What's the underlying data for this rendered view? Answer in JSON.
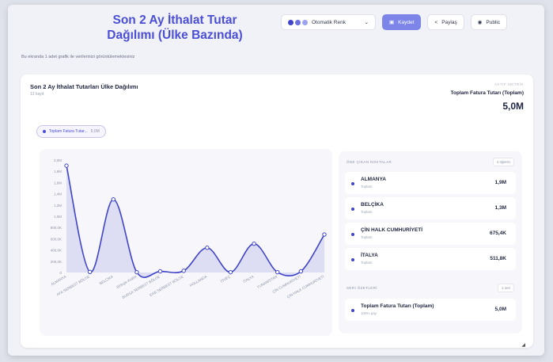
{
  "header": {
    "title": "Son 2 Ay İthalat Tutar Dağılımı (Ülke Bazında)",
    "subtitle": "Bu ekranda 1 adet grafik ile verilerinizi görüntülemektesiniz"
  },
  "toolbar": {
    "color_label": "Otomatik Renk",
    "save_label": "Kaydet",
    "share_label": "Paylaş",
    "public_label": "Public",
    "palette": [
      "#3f44c8",
      "#6b70e0",
      "#9ea3f0"
    ]
  },
  "card": {
    "title": "Son 2 Ay İthalat Tutarları Ülke Dağılımı",
    "count": "13 kayıt",
    "metric_label": "AKTİF METRİK",
    "metric_name": "Toplam Fatura Tutarı (Toplam)",
    "metric_value": "5,0M",
    "chip_label": "Toplam Fatura Tutar...",
    "chip_value": "5,0M"
  },
  "highlights": {
    "header": "ÖNE ÇIKAN NOKTALAR",
    "badge": "4 öğenin",
    "items": [
      {
        "name": "ALMANYA",
        "sub": "Toplam",
        "value": "1,9M"
      },
      {
        "name": "BELÇİKA",
        "sub": "Toplam",
        "value": "1,3M"
      },
      {
        "name": "ÇİN HALK CUMHURİYETİ",
        "sub": "Toplam",
        "value": "675,4K"
      },
      {
        "name": "İTALYA",
        "sub": "Toplam",
        "value": "511,8K"
      }
    ]
  },
  "series_summary": {
    "header": "SERİ ÖZETLERİ",
    "badge": "1 seri",
    "items": [
      {
        "name": "Toplam Fatura Tutarı (Toplam)",
        "sub": "100% pay",
        "value": "5,0M"
      }
    ]
  },
  "chart_data": {
    "type": "area",
    "categories": [
      "ALMANYA",
      "AFA SERBEST BÖLGE",
      "BELÇİKA",
      "Birleşik Krallık",
      "BURSA SERBEST BÖLGE",
      "EGE SERBEST BÖLGE",
      "HOLLANDA",
      "İSVEÇ",
      "İTALYA",
      "YUNANİSTAN",
      "ÇİN CUMHURİYETİ",
      "ÇİN HALK CUMHURİYETİ"
    ],
    "values": [
      1900000,
      10000,
      1300000,
      5000,
      20000,
      30000,
      440000,
      5000,
      511800,
      5000,
      20000,
      675400
    ],
    "ylim": [
      0,
      2000000
    ],
    "yticks": [
      "2,0M",
      "1,8M",
      "1,6M",
      "1,4M",
      "1,2M",
      "1,0M",
      "800,0K",
      "600,0K",
      "400,0K",
      "200,0K",
      "0"
    ],
    "color": "#3f44c8",
    "grid": false
  }
}
